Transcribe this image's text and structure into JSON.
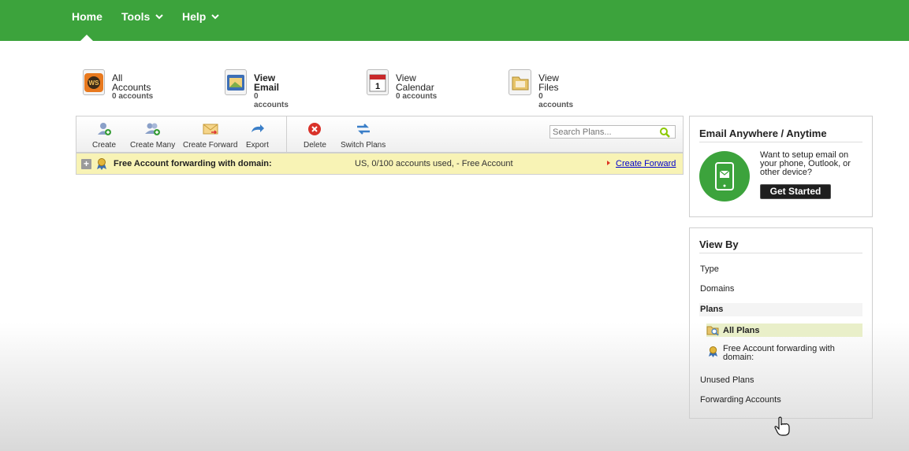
{
  "nav": {
    "items": [
      {
        "label": "Home"
      },
      {
        "label": "Tools"
      },
      {
        "label": "Help"
      }
    ]
  },
  "services": [
    {
      "title": "All Accounts",
      "count": "0 accounts"
    },
    {
      "title": "View Email",
      "count": "0 accounts"
    },
    {
      "title": "View Calendar",
      "count": "0 accounts",
      "icon_text": "1"
    },
    {
      "title": "View Files",
      "count": "0 accounts"
    }
  ],
  "toolbar": {
    "create": "Create",
    "create_many": "Create Many",
    "create_forward": "Create Forward",
    "export": "Export",
    "delete": "Delete",
    "switch_plans": "Switch Plans",
    "search_placeholder": "Search Plans..."
  },
  "plan_row": {
    "name": "Free Account forwarding with domain:",
    "status": "US, 0/100 accounts used, - Free Account",
    "action": "Create Forward"
  },
  "email_box": {
    "title": "Email Anywhere / Anytime",
    "text": "Want to setup email on your phone, Outlook, or other device?",
    "button": "Get Started"
  },
  "view_by": {
    "title": "View By",
    "type": "Type",
    "domains": "Domains",
    "plans": "Plans",
    "all_plans": "All Plans",
    "free_plan": "Free Account forwarding with domain:",
    "unused_plans": "Unused Plans",
    "forwarding_accounts": "Forwarding Accounts"
  },
  "colors": {
    "nav_green": "#3ca33c",
    "plan_row_bg": "#f8f3b5",
    "link_blue": "#0000cc"
  }
}
